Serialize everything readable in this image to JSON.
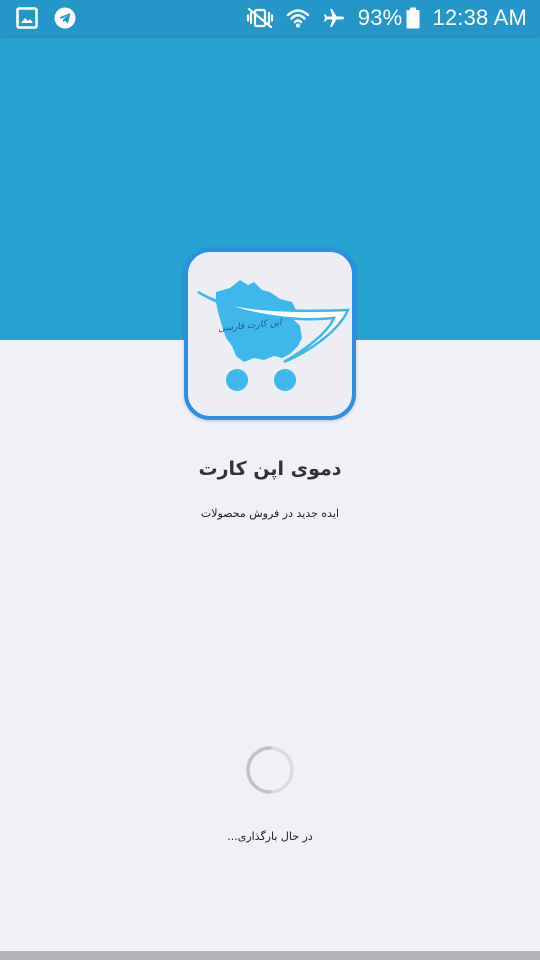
{
  "status_bar": {
    "left_icons": [
      "gallery-icon",
      "telegram-icon"
    ],
    "right_icons": [
      "vibrate-icon",
      "wifi-icon",
      "airplane-mode-icon",
      "battery-icon"
    ],
    "battery_percent": "93%",
    "battery_level": 0.93,
    "time": "12:38 AM"
  },
  "splash": {
    "app_title": "دموی اپن کارت",
    "subtitle": "ایده جدید در فروش محصولات",
    "logo_text": "اپن کارت فارسی",
    "loading_text": "در حال بارگذاری..."
  },
  "colors": {
    "status_bar": "#2596c9",
    "header": "#27a3d1",
    "background": "#f0f0f6",
    "icon_border": "#2c8fe2",
    "logo_blue": "#3fb7ea"
  }
}
